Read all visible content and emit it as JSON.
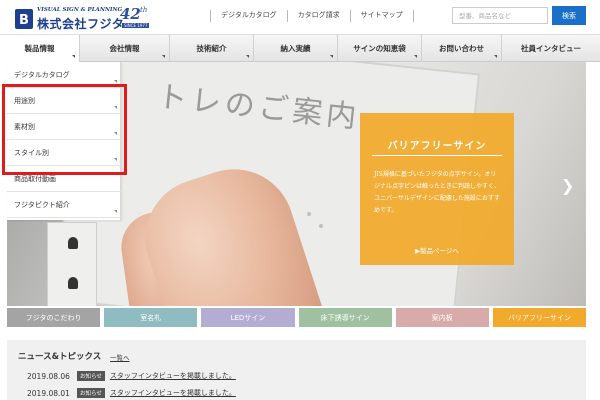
{
  "header": {
    "logo_sub": "VISUAL SIGN & PLANNING",
    "logo_main": "株式会社フジタ",
    "anniversary_number": "42",
    "anniversary_suffix": "th",
    "anniversary_since": "SINCE 1977",
    "top_links": [
      "デジタルカタログ",
      "カタログ請求",
      "サイトマップ"
    ],
    "search_placeholder": "型番、商品名など",
    "search_button": "検索"
  },
  "nav": {
    "items": [
      {
        "label": "製品情報",
        "active": true
      },
      {
        "label": "会社情報",
        "active": false
      },
      {
        "label": "技術紹介",
        "active": false
      },
      {
        "label": "納入実績",
        "active": false
      },
      {
        "label": "サインの知恵袋",
        "active": false
      },
      {
        "label": "お問い合わせ",
        "active": false
      },
      {
        "label": "社員インタビュー",
        "active": false
      }
    ]
  },
  "dropdown": {
    "items": [
      {
        "label": "デジタルカタログ",
        "has_sub": true
      },
      {
        "label": "用途別",
        "has_sub": true
      },
      {
        "label": "素材別",
        "has_sub": true
      },
      {
        "label": "スタイル別",
        "has_sub": true
      },
      {
        "label": "商品取付動画",
        "has_sub": false
      },
      {
        "label": "フジタピクト紹介",
        "has_sub": true
      }
    ],
    "highlight_color": "#e01b1b"
  },
  "hero": {
    "sign_text": "トレのご案内",
    "promo_title": "バリアフリーサイン",
    "promo_desc": "JIS規格に基づいたフジタの点字サイン。オリジナル点字ピンは触ったときに判読しやすく、ユニバーサルデザインに配慮した施設におすすめです。",
    "promo_link": "▶製品ページへ",
    "next_icon": "chevron-right-icon",
    "promo_color": "#f1aa2b"
  },
  "categories": [
    {
      "label": "フジタのこだわり",
      "color": "#a4a4a4"
    },
    {
      "label": "室名札",
      "color": "#8ebcc0"
    },
    {
      "label": "LEDサイン",
      "color": "#b3add4"
    },
    {
      "label": "床下誘導サイン",
      "color": "#9fc1a0"
    },
    {
      "label": "案内板",
      "color": "#d8aaa9"
    },
    {
      "label": "バリアフリーサイン",
      "color": "#f1aa2b"
    }
  ],
  "news": {
    "title": "ニュース&トピックス",
    "more": "一覧へ",
    "items": [
      {
        "date": "2019.08.06",
        "badge": "お知らせ",
        "text": "スタッフインタビューを掲載しました。"
      },
      {
        "date": "2019.08.01",
        "badge": "お知らせ",
        "text": "スタッフインタビューを掲載しました。"
      }
    ]
  }
}
